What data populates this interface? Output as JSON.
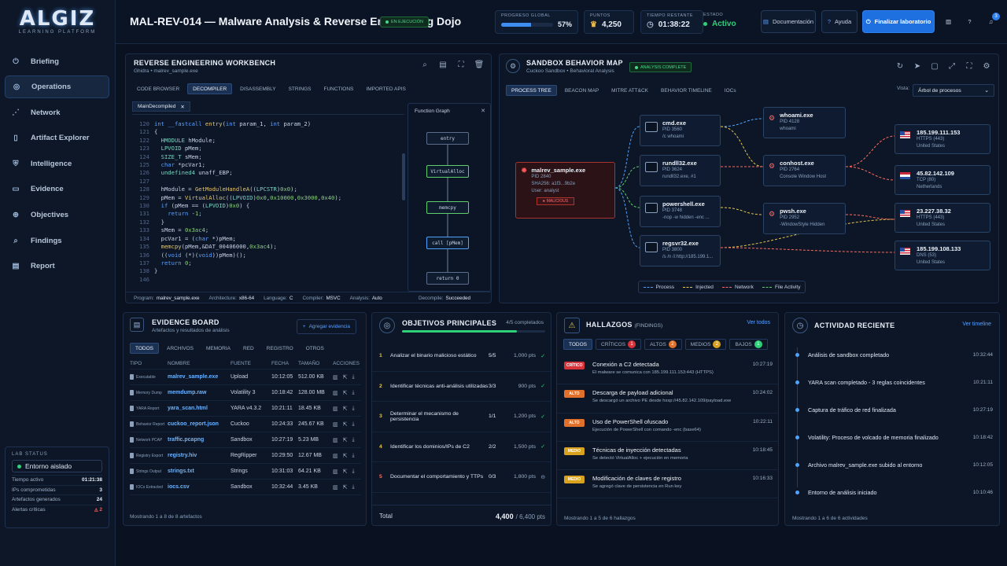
{
  "brand": {
    "logo": "ALGIZ",
    "tagline": "LEARNING PLATFORM"
  },
  "sidebar": {
    "items": [
      {
        "label": "Briefing",
        "icon": "power-icon"
      },
      {
        "label": "Operations",
        "icon": "target-icon"
      },
      {
        "label": "Network",
        "icon": "network-icon"
      },
      {
        "label": "Artifact Explorer",
        "icon": "file-icon"
      },
      {
        "label": "Intelligence",
        "icon": "shield-icon"
      },
      {
        "label": "Evidence",
        "icon": "shield-doc-icon"
      },
      {
        "label": "Objectives",
        "icon": "crosshair-icon"
      },
      {
        "label": "Findings",
        "icon": "search-icon"
      },
      {
        "label": "Report",
        "icon": "report-icon"
      }
    ],
    "active": "Operations"
  },
  "lab_status": {
    "title": "LAB STATUS",
    "env": "Entorno aislado",
    "rows": [
      {
        "label": "Tiempo activo",
        "value": "01:21:38"
      },
      {
        "label": "IPs comprometidas",
        "value": "3"
      },
      {
        "label": "Artefactos generados",
        "value": "24"
      },
      {
        "label": "Alertas críticas",
        "value": "2"
      }
    ]
  },
  "header": {
    "title": "MAL-REV-014 — Malware Analysis & Reverse Engineering Dojo",
    "status": "EN EJECUCIÓN",
    "progress_label": "PROGRESO GLOBAL",
    "progress_value": "57%",
    "progress_fraction": 0.57,
    "points_label": "PUNTOS",
    "points_value": "4,250",
    "time_label": "TIEMPO RESTANTE",
    "time_value": "01:38:22",
    "state_label": "ESTADO",
    "state_value": "Activo",
    "doc_button": "Documentación",
    "help_button": "Ayuda",
    "finish_button": "Finalizar laboratorio",
    "notif_count": "3"
  },
  "workbench": {
    "title": "REVERSE ENGINEERING WORKBENCH",
    "subtitle": "Ghidra  •  malrev_sample.exe",
    "tabs": [
      "CODE BROWSER",
      "DECOMPILER",
      "DISASSEMBLY",
      "STRINGS",
      "FUNCTIONS",
      "IMPORTED APIS"
    ],
    "active_tab": "DECOMPILER",
    "file_tab": "MainDecompiled",
    "graph_title": "Function Graph",
    "graph_nodes": [
      "entry",
      "VirtualAlloc",
      "memcpy",
      "call [pMem]",
      "return 0"
    ],
    "code_lines": [
      {
        "n": "120",
        "t": "int __fastcall entry(int param_1, int param_2)"
      },
      {
        "n": "121",
        "t": "{"
      },
      {
        "n": "122",
        "t": "  HMODULE hModule;"
      },
      {
        "n": "123",
        "t": "  LPVOID pMem;"
      },
      {
        "n": "124",
        "t": "  SIZE_T sMem;"
      },
      {
        "n": "125",
        "t": "  char *pcVar1;"
      },
      {
        "n": "126",
        "t": "  undefined4 unaff_EBP;"
      },
      {
        "n": "127",
        "t": ""
      },
      {
        "n": "128",
        "t": "  hModule = GetModuleHandleA((LPCSTR)0x0);"
      },
      {
        "n": "129",
        "t": "  pMem = VirtualAlloc((LPVOID)0x0,0x10000,0x3000,0x40);"
      },
      {
        "n": "130",
        "t": "  if (pMem == (LPVOID)0x0) {"
      },
      {
        "n": "131",
        "t": "    return -1;"
      },
      {
        "n": "132",
        "t": "  }"
      },
      {
        "n": "133",
        "t": "  sMem = 0x3ac4;"
      },
      {
        "n": "134",
        "t": "  pcVar1 = (char *)pMem;"
      },
      {
        "n": "135",
        "t": "  memcpy(pMem,&DAT_00406000,0x3ac4);"
      },
      {
        "n": "136",
        "t": "  ((void (*)(void))pMem)();"
      },
      {
        "n": "137",
        "t": "  return 0;"
      },
      {
        "n": "138",
        "t": "}"
      },
      {
        "n": "146",
        "t": ""
      }
    ],
    "footer": [
      {
        "label": "Program:",
        "value": "malrev_sample.exe"
      },
      {
        "label": "Architecture:",
        "value": "x86-64"
      },
      {
        "label": "Language:",
        "value": "C"
      },
      {
        "label": "Compiler:",
        "value": "MSVC"
      },
      {
        "label": "Analysis:",
        "value": "Auto"
      },
      {
        "label": "Decompile:",
        "value": "Succeeded"
      }
    ]
  },
  "sandbox": {
    "title": "SANDBOX BEHAVIOR MAP",
    "subtitle": "Cuckoo Sandbox  •  Behavioral Analysis",
    "badge": "ANALYSIS COMPLETE",
    "tabs": [
      "PROCESS TREE",
      "BEACON MAP",
      "MITRE ATT&CK",
      "BEHAVIOR TIMELINE",
      "IOCs"
    ],
    "active_tab": "PROCESS TREE",
    "view_label": "Vista:",
    "view_value": "Árbol de procesos",
    "root": {
      "name": "malrev_sample.exe",
      "lines": [
        "PID 2840",
        "SHA256: a1f3...9b2e",
        "User: analyst"
      ],
      "badge": "MALICIOUS"
    },
    "children": [
      {
        "name": "cmd.exe",
        "lines": [
          "PID 3560",
          "/c whoami"
        ]
      },
      {
        "name": "rundll32.exe",
        "lines": [
          "PID 3624",
          "rundll32.exe, #1"
        ]
      },
      {
        "name": "powershell.exe",
        "lines": [
          "PID 3748",
          "-nop -w hidden -enc ..."
        ]
      },
      {
        "name": "regsvr32.exe",
        "lines": [
          "PID 3800",
          "/s /n /i:http://185.199.1..."
        ]
      }
    ],
    "grandchildren": [
      {
        "name": "whoami.exe",
        "lines": [
          "PID 4128",
          "whoami"
        ]
      },
      {
        "name": "conhost.exe",
        "lines": [
          "PID 2764",
          "Console Window Host"
        ]
      },
      {
        "name": "pwsh.exe",
        "lines": [
          "PID 2952",
          "-WindowStyle Hidden"
        ]
      }
    ],
    "hosts": [
      {
        "ip": "185.199.111.153",
        "proto": "HTTPS (443)",
        "country": "United States"
      },
      {
        "ip": "45.82.142.109",
        "proto": "TCP (80)",
        "country": "Netherlands"
      },
      {
        "ip": "23.227.38.32",
        "proto": "HTTPS (443)",
        "country": "United States"
      },
      {
        "ip": "185.199.108.133",
        "proto": "DNS (53)",
        "country": "United States"
      }
    ],
    "legend": [
      {
        "label": "Process",
        "color": "#4ea3ff"
      },
      {
        "label": "Injected",
        "color": "#e6c64e"
      },
      {
        "label": "Network",
        "color": "#ff6b5e"
      },
      {
        "label": "File Activity",
        "color": "#5ecf6a"
      }
    ]
  },
  "evidence": {
    "title": "EVIDENCE BOARD",
    "subtitle": "Artefactos y resultados de análisis",
    "add_button": "Agregar evidencia",
    "tabs": [
      "TODOS",
      "ARCHIVOS",
      "MEMORIA",
      "RED",
      "REGISTRO",
      "OTROS"
    ],
    "headers": [
      "TIPO",
      "NOMBRE",
      "FUENTE",
      "FECHA",
      "TAMAÑO",
      "ACCIONES"
    ],
    "rows": [
      {
        "type": "Executable",
        "name": "malrev_sample.exe",
        "source": "Upload",
        "date": "10:12:05",
        "size": "512.00 KB"
      },
      {
        "type": "Memory Dump",
        "name": "memdump.raw",
        "source": "Volatility 3",
        "date": "10:18:42",
        "size": "128.00 MB"
      },
      {
        "type": "YARA Report",
        "name": "yara_scan.html",
        "source": "YARA v4.3.2",
        "date": "10:21:11",
        "size": "18.45 KB"
      },
      {
        "type": "Behavior Report",
        "name": "cuckoo_report.json",
        "source": "Cuckoo",
        "date": "10:24:33",
        "size": "245.67 KB"
      },
      {
        "type": "Network PCAP",
        "name": "traffic.pcapng",
        "source": "Sandbox",
        "date": "10:27:19",
        "size": "5.23 MB"
      },
      {
        "type": "Registry Export",
        "name": "registry.hiv",
        "source": "RegRipper",
        "date": "10:29:50",
        "size": "12.67 MB"
      },
      {
        "type": "Strings Output",
        "name": "strings.txt",
        "source": "Strings",
        "date": "10:31:03",
        "size": "64.21 KB"
      },
      {
        "type": "IOCs Extracted",
        "name": "iocs.csv",
        "source": "Sandbox",
        "date": "10:32:44",
        "size": "3.45 KB"
      }
    ],
    "footer": "Mostrando 1 a 8 de 8 artefactos"
  },
  "objectives": {
    "title": "OBJETIVOS PRINCIPALES",
    "completed": "4/5 completados",
    "progress_fraction": 0.8,
    "items": [
      {
        "n": "1",
        "text": "Analizar el binario malicioso estático",
        "score": "5/5",
        "pts": "1,000 pts",
        "done": true
      },
      {
        "n": "2",
        "text": "Identificar técnicas anti-análisis utilizadas",
        "score": "3/3",
        "pts": "900 pts",
        "done": true
      },
      {
        "n": "3",
        "text": "Determinar el mecanismo de persistencia",
        "score": "1/1",
        "pts": "1,200 pts",
        "done": true
      },
      {
        "n": "4",
        "text": "Identificar los dominios/IPs de C2",
        "score": "2/2",
        "pts": "1,500 pts",
        "done": true
      },
      {
        "n": "5",
        "text": "Documentar el comportamiento y TTPs",
        "score": "0/3",
        "pts": "1,800 pts",
        "done": false
      }
    ],
    "total_label": "Total",
    "total_value": "4,400",
    "total_max": "/ 6,400 pts"
  },
  "findings": {
    "title": "HALLAZGOS",
    "title_sub": "(FINDINGS)",
    "see_all": "Ver todos",
    "tabs": [
      {
        "label": "TODOS",
        "count": ""
      },
      {
        "label": "CRÍTICOS",
        "count": "1"
      },
      {
        "label": "ALTOS",
        "count": "2"
      },
      {
        "label": "MEDIOS",
        "count": "2"
      },
      {
        "label": "BAJOS",
        "count": "1"
      }
    ],
    "items": [
      {
        "sev": "CRÍTICO",
        "color": "#d8323a",
        "title": "Conexión a C2 detectada",
        "desc": "El malware se comunica con 185.199.111.153:443 (HTTPS)",
        "time": "10:27:19"
      },
      {
        "sev": "ALTO",
        "color": "#e0702a",
        "title": "Descarga de payload adicional",
        "desc": "Se descargó un archivo PE desde hxxp://45.82.142.109/payload.exe",
        "time": "10:24:02"
      },
      {
        "sev": "ALTO",
        "color": "#e0702a",
        "title": "Uso de PowerShell ofuscado",
        "desc": "Ejecución de PowerShell con comando -enc (base64)",
        "time": "10:22:11"
      },
      {
        "sev": "MEDIO",
        "color": "#d8a21f",
        "title": "Técnicas de inyección detectadas",
        "desc": "Se detectó VirtualAlloc + ejecución en memoria",
        "time": "10:18:45"
      },
      {
        "sev": "MEDIO",
        "color": "#d8a21f",
        "title": "Modificación de claves de registro",
        "desc": "Se agregó clave de persistencia en Run key",
        "time": "10:16:33"
      }
    ],
    "footer": "Mostrando 1 a 5 de 6 hallazgos"
  },
  "activity": {
    "title": "ACTIVIDAD RECIENTE",
    "see_all": "Ver timeline",
    "items": [
      {
        "text": "Análisis de sandbox completado",
        "time": "10:32:44"
      },
      {
        "text": "YARA scan completado - 3 reglas coincidentes",
        "time": "10:21:11"
      },
      {
        "text": "Captura de tráfico de red finalizada",
        "time": "10:27:19"
      },
      {
        "text": "Volatility: Proceso de volcado de memoria finalizado",
        "time": "10:18:42"
      },
      {
        "text": "Archivo malrev_sample.exe subido al entorno",
        "time": "10:12:05"
      },
      {
        "text": "Entorno de análisis iniciado",
        "time": "10:10:46"
      }
    ],
    "footer": "Mostrando 1 a 6 de 6 actividades"
  },
  "colors": {
    "accent": "#1f6fe0",
    "success": "#2fd07a",
    "critical": "#d8323a"
  }
}
